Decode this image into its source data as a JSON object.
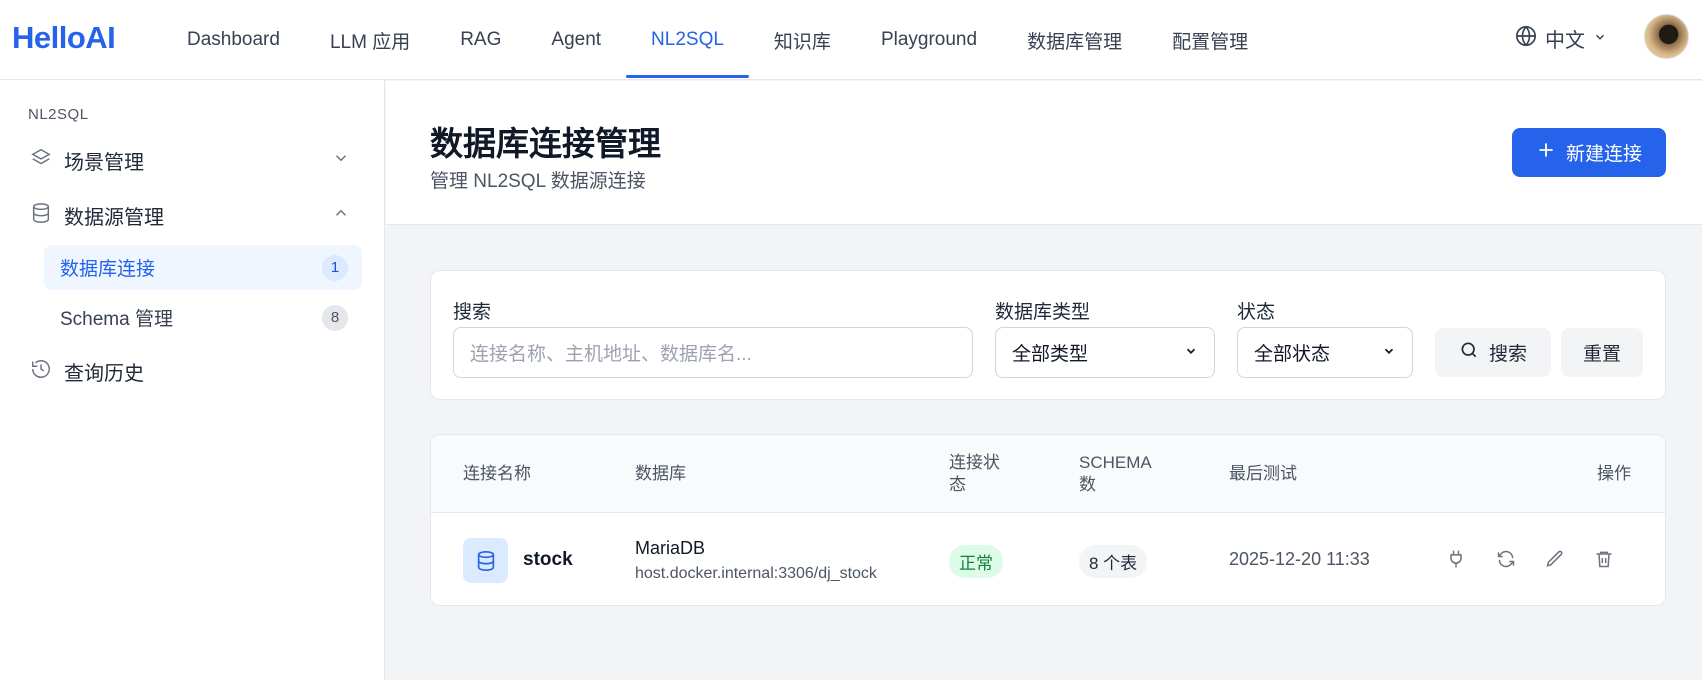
{
  "app": {
    "logo": "HelloAI"
  },
  "nav": {
    "items": [
      {
        "label": "Dashboard"
      },
      {
        "label": "LLM 应用"
      },
      {
        "label": "RAG"
      },
      {
        "label": "Agent"
      },
      {
        "label": "NL2SQL"
      },
      {
        "label": "知识库"
      },
      {
        "label": "Playground"
      },
      {
        "label": "数据库管理"
      },
      {
        "label": "配置管理"
      }
    ],
    "active": "NL2SQL",
    "language": "中文"
  },
  "sidebar": {
    "section": "NL2SQL",
    "groups": [
      {
        "label": "场景管理",
        "icon": "layers-icon",
        "expanded": false
      },
      {
        "label": "数据源管理",
        "icon": "database-icon",
        "expanded": true
      },
      {
        "label": "查询历史",
        "icon": "history-icon"
      }
    ],
    "subitems": [
      {
        "label": "数据库连接",
        "count": "1",
        "active": true
      },
      {
        "label": "Schema 管理",
        "count": "8",
        "active": false
      }
    ]
  },
  "header": {
    "title": "数据库连接管理",
    "subtitle": "管理 NL2SQL 数据源连接",
    "new_button": "新建连接"
  },
  "filters": {
    "search_label": "搜索",
    "search_placeholder": "连接名称、主机地址、数据库名...",
    "type_label": "数据库类型",
    "type_value": "全部类型",
    "status_label": "状态",
    "status_value": "全部状态",
    "search_button": "搜索",
    "reset_button": "重置"
  },
  "table": {
    "columns": [
      "连接名称",
      "数据库",
      "连接状态",
      "SCHEMA数",
      "最后测试",
      "操作"
    ],
    "column_lines": {
      "status": [
        "连接状",
        "态"
      ],
      "schema": [
        "SCHEMA",
        "数"
      ]
    },
    "rows": [
      {
        "name": "stock",
        "db_type": "MariaDB",
        "host": "host.docker.internal:3306/dj_stock",
        "status": "正常",
        "schema_count": "8 个表",
        "last_test": "2025-12-20 11:33"
      }
    ]
  },
  "colors": {
    "primary": "#2563eb",
    "status_ok_bg": "#dcfce7",
    "status_ok_text": "#15803d"
  }
}
